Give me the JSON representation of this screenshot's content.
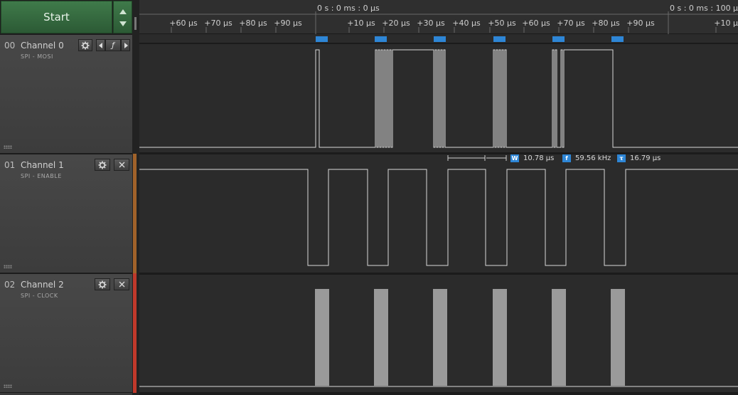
{
  "toolbar": {
    "start_label": "Start"
  },
  "timeline": {
    "origin_label_1": "0 s : 0 ms : 0 µs",
    "origin_label_2": "0 s : 0 ms : 100 µs",
    "ticks": [
      "+60 µs",
      "+70 µs",
      "+80 µs",
      "+90 µs",
      "+10 µs",
      "+20 µs",
      "+30 µs",
      "+40 µs",
      "+50 µs",
      "+60 µs",
      "+70 µs",
      "+80 µs",
      "+90 µs",
      "+10 µs"
    ]
  },
  "channels": [
    {
      "num": "00",
      "name": "Channel 0",
      "subtitle": "SPI - MOSI",
      "color": "#3a3a3a"
    },
    {
      "num": "01",
      "name": "Channel 1",
      "subtitle": "SPI - ENABLE",
      "color": "#a0622a"
    },
    {
      "num": "02",
      "name": "Channel 2",
      "subtitle": "SPI - CLOCK",
      "color": "#c0392b"
    }
  ],
  "measurements": {
    "width_icon": "W",
    "width_value": "10.78 µs",
    "freq_icon": "f",
    "freq_value": "59.56 kHz",
    "period_icon": "τ",
    "period_value": "16.79 µs"
  },
  "icons": {
    "gear": "gear-icon",
    "edge": "falling-edge-icon",
    "close": "close-icon"
  },
  "colors": {
    "accent": "#2e86d6",
    "start_green": "#3f7a4a"
  }
}
